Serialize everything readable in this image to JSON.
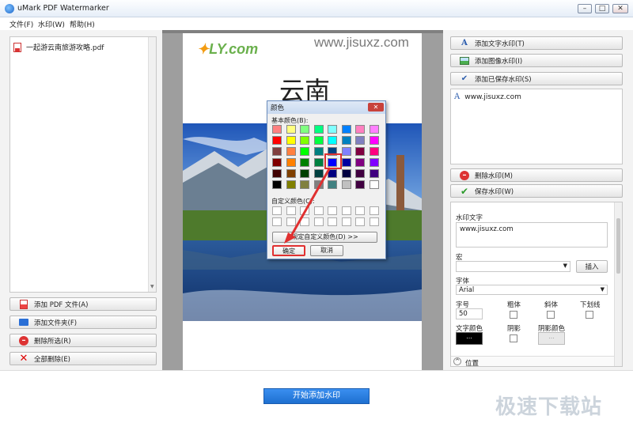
{
  "window": {
    "title": "uMark PDF Watermarker",
    "minimize": "–",
    "maximize": "□",
    "close": "✕"
  },
  "menu": [
    "文件(F)",
    "水印(W)",
    "帮助(H)"
  ],
  "file_list": {
    "items": [
      "一起游云南旅游攻略.pdf"
    ]
  },
  "left_buttons": {
    "add_pdf": "添加 PDF 文件(A)",
    "add_folder": "添加文件夹(F)",
    "delete_selected": "删除所选(R)",
    "delete_all": "全部删除(E)"
  },
  "preview": {
    "watermark_text": "www.jisuxz.com",
    "logo_text": "LY.com",
    "page_title": "云南"
  },
  "color_dialog": {
    "title": "颜色",
    "basic_colors_label": "基本颜色(B):",
    "custom_colors_label": "自定义颜色(C):",
    "define_custom": "规定自定义颜色(D) >>",
    "ok": "确定",
    "cancel": "取消",
    "colors": [
      "#ff8080",
      "#ffff80",
      "#80ff80",
      "#00ff80",
      "#80ffff",
      "#0080ff",
      "#ff80c0",
      "#ff80ff",
      "#ff0000",
      "#ffff00",
      "#80ff00",
      "#00ff40",
      "#00ffff",
      "#0080c0",
      "#8080c0",
      "#ff00ff",
      "#804040",
      "#ff8040",
      "#00ff00",
      "#008080",
      "#004080",
      "#8080ff",
      "#800040",
      "#ff0080",
      "#800000",
      "#ff8000",
      "#008000",
      "#008040",
      "#0000ff",
      "#0000a0",
      "#800080",
      "#8000ff",
      "#400000",
      "#804000",
      "#004000",
      "#004040",
      "#000080",
      "#000040",
      "#400040",
      "#400080",
      "#000000",
      "#808000",
      "#808040",
      "#808080",
      "#408080",
      "#c0c0c0",
      "#400040",
      "#ffffff"
    ],
    "selected_color": "#0000ff"
  },
  "right_buttons": {
    "add_text_watermark": "添加文字水印(T)",
    "add_image_watermark": "添加图像水印(I)",
    "add_saved_watermark": "添加已保存水印(S)",
    "delete_watermark": "删除水印(M)",
    "save_watermark": "保存水印(W)"
  },
  "watermark_list": [
    "www.jisuxz.com"
  ],
  "properties": {
    "watermark_text_label": "水印文字",
    "watermark_text_value": "www.jisuxz.com",
    "macro_label": "宏",
    "insert_button": "插入",
    "font_label": "字体",
    "font_value": "Arial",
    "size_label": "字号",
    "size_value": "50",
    "bold_label": "粗体",
    "italic_label": "斜体",
    "underline_label": "下划线",
    "text_color_label": "文字颜色",
    "text_color_button": "...",
    "shadow_label": "阴影",
    "shadow_color_label": "阴影颜色",
    "shadow_color_button": "...",
    "position_label": "位置"
  },
  "start_button": "开始添加水印",
  "site_watermark": "极速下载站"
}
